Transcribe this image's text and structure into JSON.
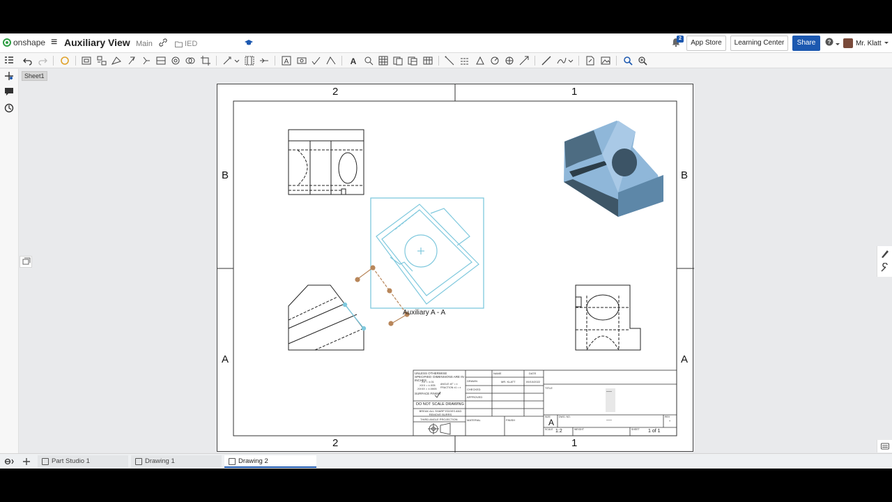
{
  "header": {
    "brand": "onshape",
    "doc_title": "Auxiliary View",
    "branch": "Main",
    "folder": "IED",
    "notifications_count": "2",
    "app_store": "App Store",
    "learning_center": "Learning Center",
    "share": "Share",
    "help": "?",
    "user": "Mr. Klatt"
  },
  "sheet_tab": "Sheet1",
  "drawing": {
    "zone_top_left": "2",
    "zone_top_right": "1",
    "zone_bottom_left": "2",
    "zone_bottom_right": "1",
    "zone_left_upper": "B",
    "zone_left_lower": "A",
    "zone_right_upper": "B",
    "zone_right_lower": "A",
    "aux_view_label": "Auxiliary A - A"
  },
  "title_block": {
    "tolerance_note": "UNLESS OTHERWISE SPECIFIED: DIMENSIONS ARE IN INCHES",
    "tol1": ".XX = ±.01",
    "tol2": ".XXX = ±.005",
    "tol3": ".XXXX = ±.0005",
    "angle": "ANGLE ±0° = ±",
    "fraction": "FRACTION ±1 = ±",
    "surface_finish": "SURFACE FINISH",
    "do_not_scale": "DO NOT SCALE DRAWING",
    "break_edges": "BREAK ALL SHARP EDGES AND REMOVE BURRS",
    "projection": "THIRD ANGLE PROJECTION",
    "name_hdr": "NAME",
    "date_hdr": "DATE",
    "drawn": "DRAWN",
    "drawn_name": "MR. KLATT",
    "drawn_date": "09/10/2022",
    "checked": "CHECKED",
    "approved": "APPROVED",
    "material": "MATERIAL",
    "finish": "FINISH",
    "title_hdr": "TITLE",
    "title_val": "----",
    "size_hdr": "SIZE",
    "size_val": "A",
    "dwg_no_hdr": "DWG. NO.",
    "dwg_no_val": "----",
    "rev_hdr": "REV",
    "rev_val": "-",
    "scale_hdr": "SCALE",
    "scale_val": "1:2",
    "weight_hdr": "WEIGHT",
    "sheet_hdr": "SHEET",
    "sheet_val": "1 of 1"
  },
  "tabs": [
    {
      "label": "Part Studio 1"
    },
    {
      "label": "Drawing 1"
    },
    {
      "label": "Drawing 2"
    }
  ],
  "colors": {
    "brand_green": "#2f9e44",
    "accent_blue": "#1c58b0",
    "aux_view": "#7ec8dd",
    "iso_face": "#8fb7d9",
    "iso_dark": "#3e5667",
    "handle": "#b8865a"
  }
}
